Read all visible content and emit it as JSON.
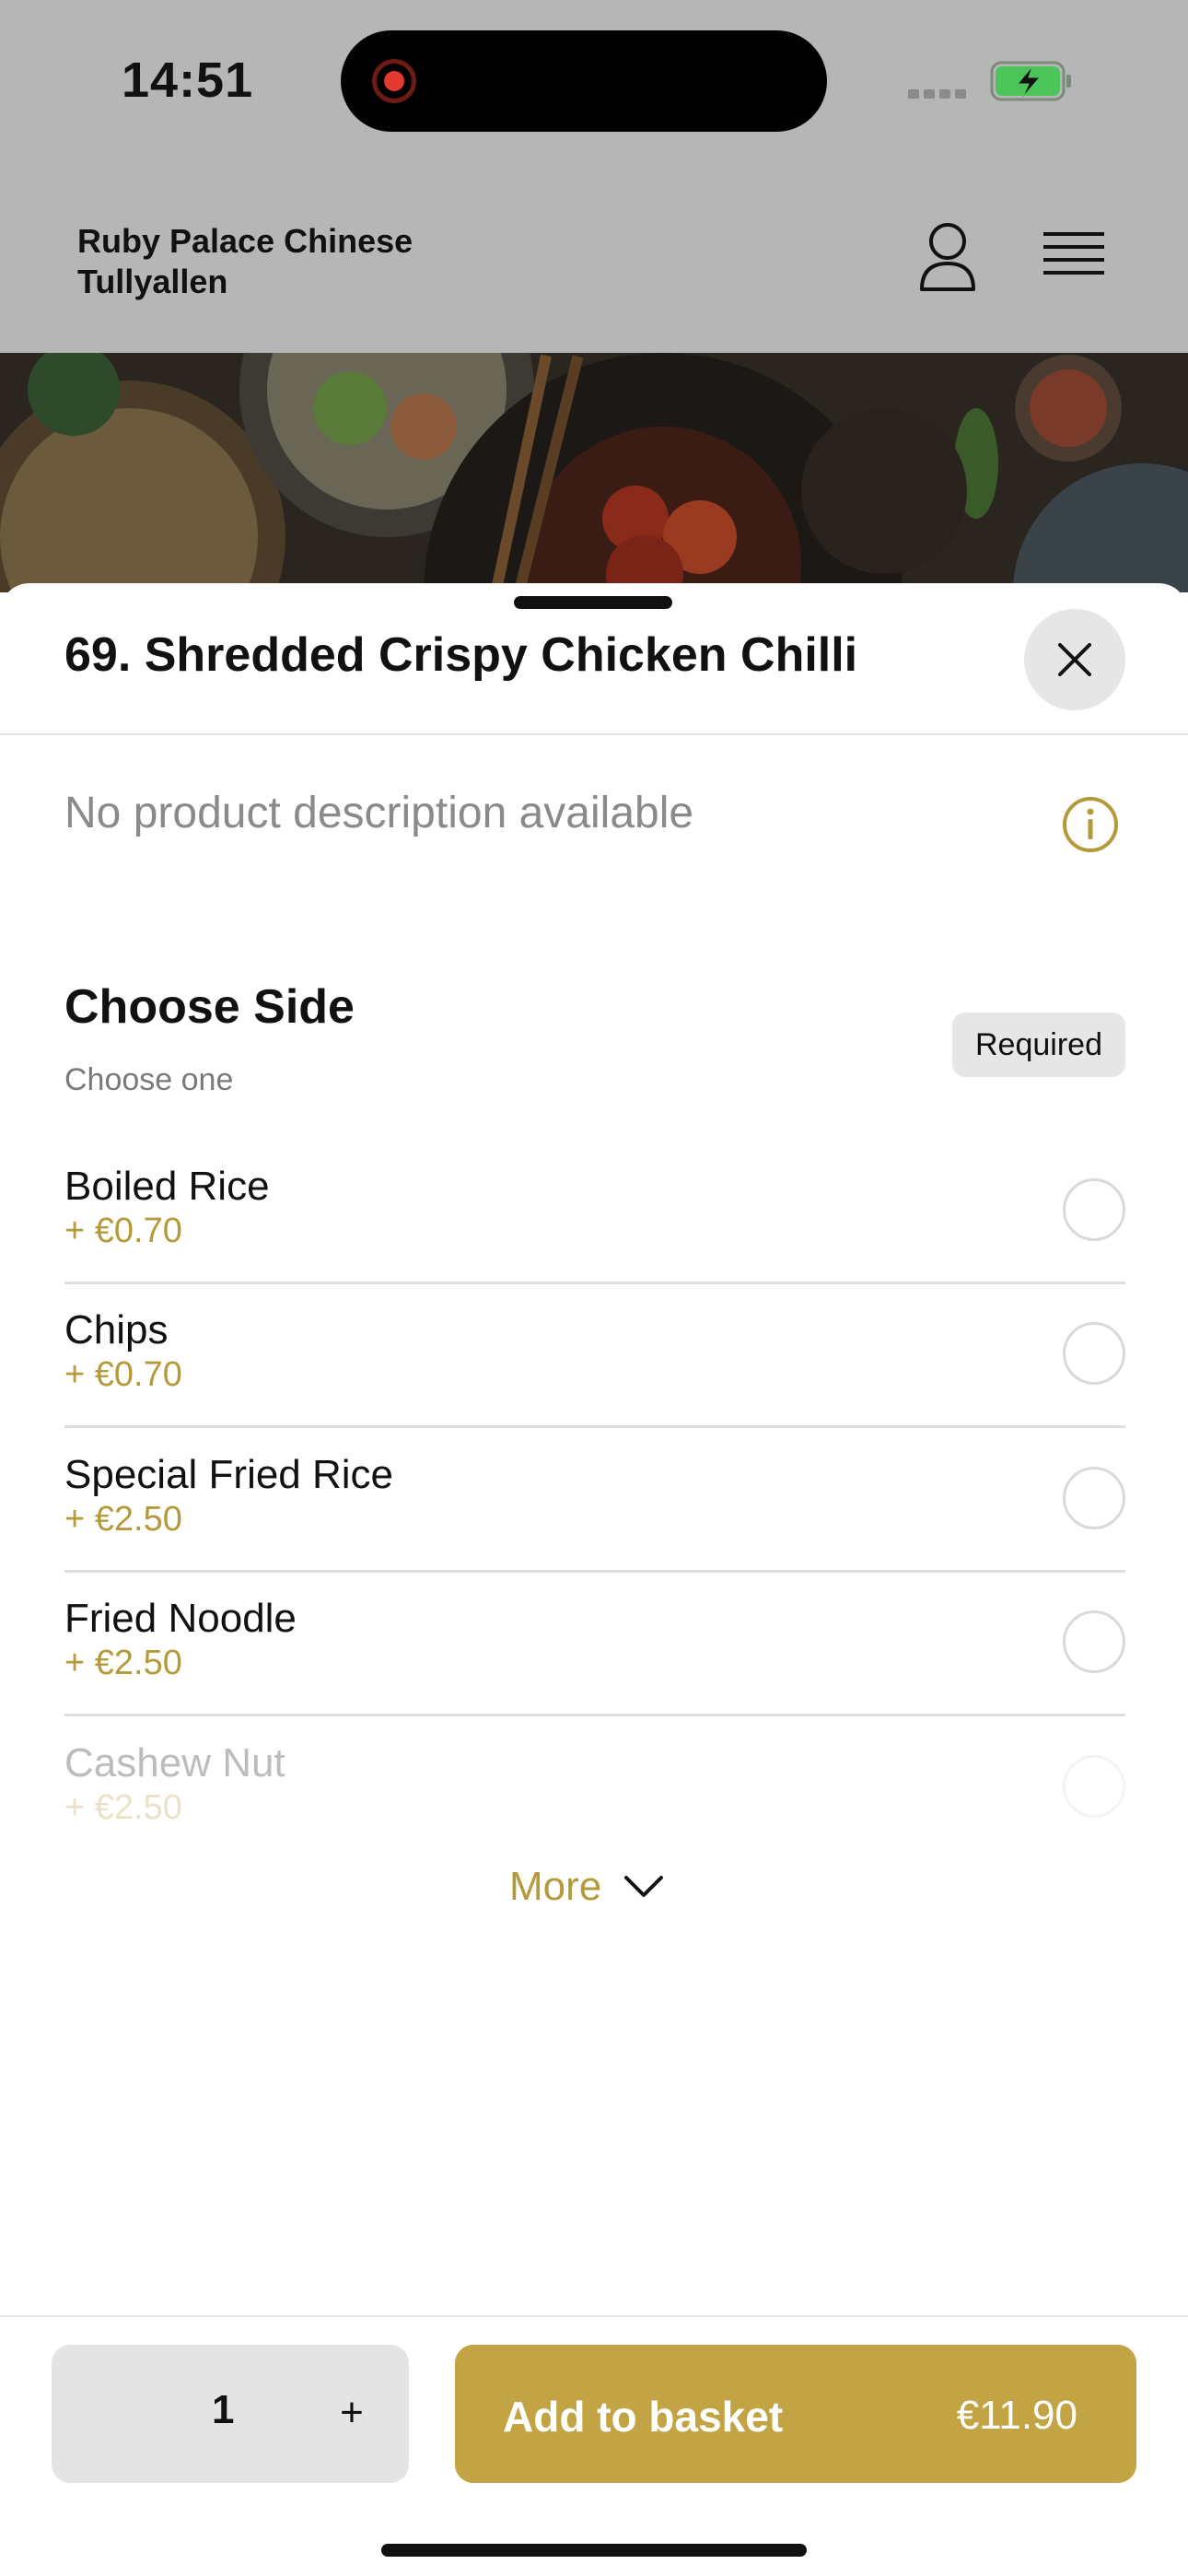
{
  "status_bar": {
    "time": "14:51"
  },
  "header": {
    "restaurant_name": "Ruby Palace Chinese Tullyallen"
  },
  "product": {
    "title": "69. Shredded Crispy Chicken Chilli",
    "description": "No product description available"
  },
  "option_group": {
    "title": "Choose Side",
    "subtitle": "Choose one",
    "badge": "Required",
    "options": [
      {
        "name": "Boiled Rice",
        "price": "+ €0.70"
      },
      {
        "name": "Chips",
        "price": "+ €0.70"
      },
      {
        "name": "Special Fried Rice",
        "price": "+ €2.50"
      },
      {
        "name": "Fried Noodle",
        "price": "+ €2.50"
      },
      {
        "name": "Cashew Nut",
        "price": "+ €2.50"
      }
    ],
    "more_label": "More"
  },
  "footer": {
    "quantity": "1",
    "plus_label": "+",
    "add_label": "Add to basket",
    "total": "€11.90"
  },
  "colors": {
    "accent": "#c2a444",
    "price_text": "#b59a3c",
    "overlay_gray": "#b6b6b6"
  },
  "icons": [
    "record-icon",
    "signal-icon",
    "battery-charging-icon",
    "user-icon",
    "hamburger-menu-icon",
    "close-icon",
    "info-icon",
    "chevron-down-icon"
  ]
}
